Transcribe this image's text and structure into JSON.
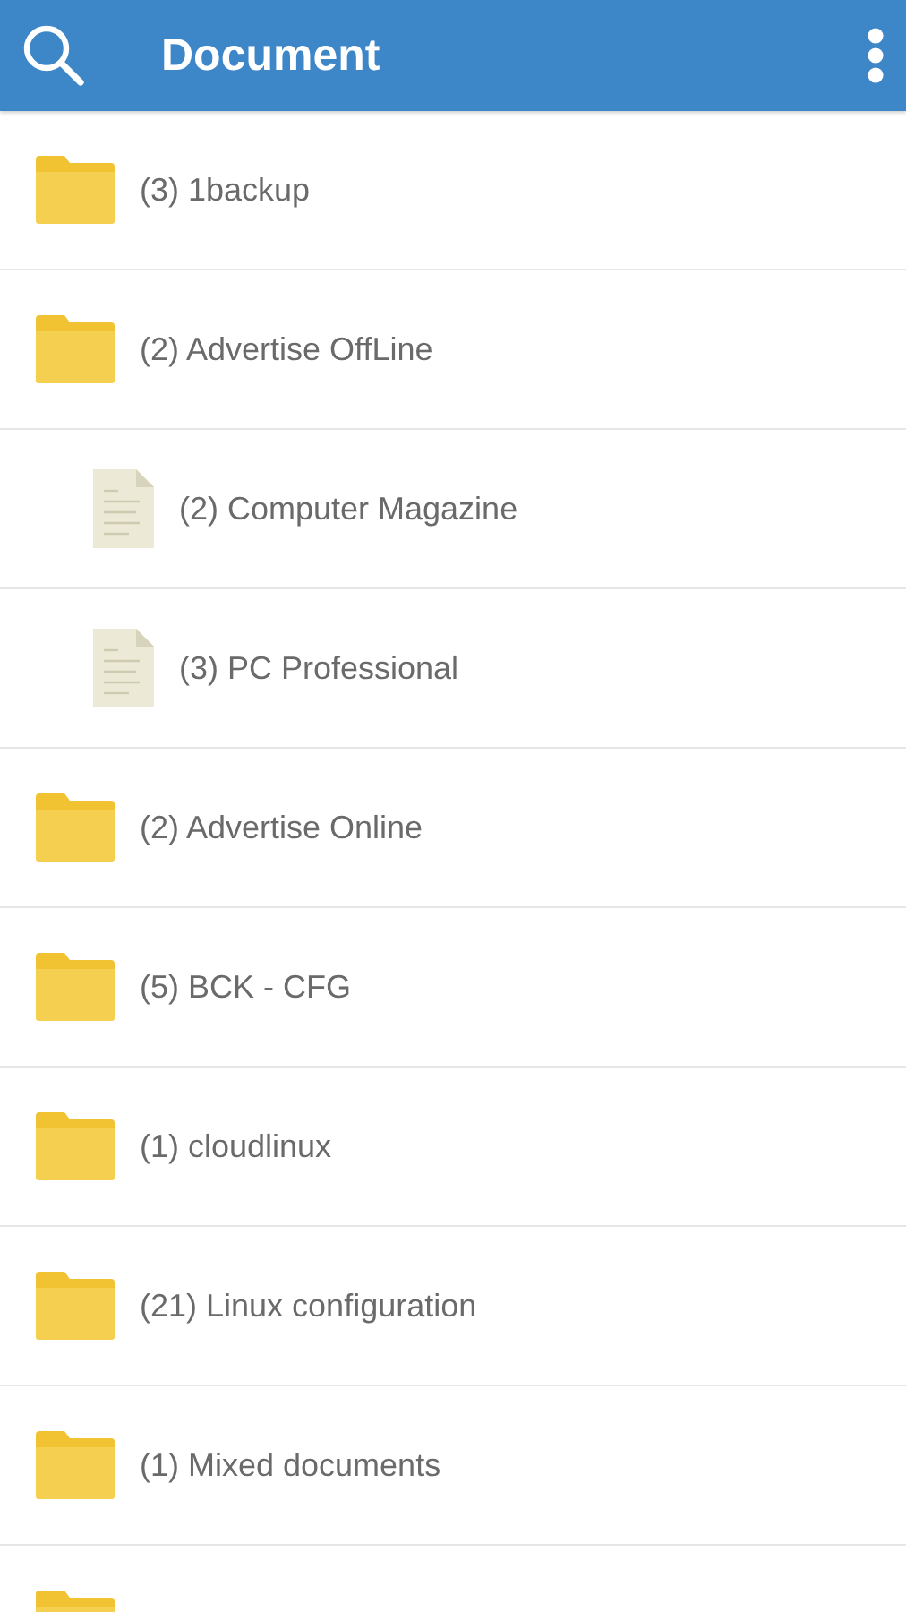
{
  "app_bar": {
    "title": "Document"
  },
  "items": [
    {
      "kind": "folder",
      "label": "(3) 1backup"
    },
    {
      "kind": "folder",
      "label": "(2) Advertise OffLine",
      "children": [
        {
          "kind": "file",
          "label": "(2) Computer Magazine"
        },
        {
          "kind": "file",
          "label": "(3) PC Professional"
        }
      ]
    },
    {
      "kind": "folder",
      "label": "(2) Advertise Online"
    },
    {
      "kind": "folder",
      "label": "(5) BCK - CFG"
    },
    {
      "kind": "folder",
      "label": "(1) cloudlinux"
    },
    {
      "kind": "folder",
      "label": "(21) Linux configuration"
    },
    {
      "kind": "folder",
      "label": "(1) Mixed documents"
    },
    {
      "kind": "folder"
    }
  ]
}
